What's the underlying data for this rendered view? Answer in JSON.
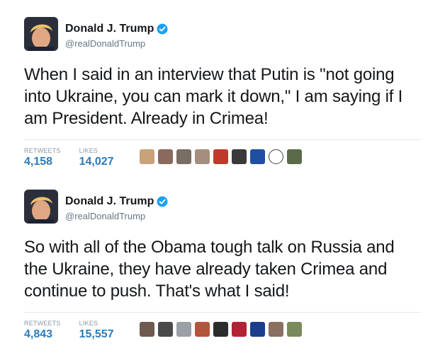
{
  "tweets": [
    {
      "author_name": "Donald J. Trump",
      "handle": "@realDonaldTrump",
      "text": "When I said in an interview that Putin is \"not going into Ukraine, you can mark it down,\" I am saying if I am President. Already in Crimea!",
      "retweets_label": "RETWEETS",
      "retweets": "4,158",
      "likes_label": "LIKES",
      "likes": "14,027",
      "liker_avatars": [
        {
          "icon": "liker-avatar-icon",
          "color": "#c9a27a"
        },
        {
          "icon": "liker-avatar-icon",
          "color": "#8a6a5c"
        },
        {
          "icon": "liker-avatar-icon",
          "color": "#7a6e62"
        },
        {
          "icon": "liker-avatar-icon",
          "color": "#a58f7c"
        },
        {
          "icon": "liker-avatar-icon",
          "color": "#c0392b"
        },
        {
          "icon": "liker-avatar-icon",
          "color": "#3a3a3a"
        },
        {
          "icon": "liker-avatar-icon",
          "color": "#1f4fa0"
        },
        {
          "icon": "liker-avatar-icon",
          "color": "#ffffff"
        },
        {
          "icon": "liker-avatar-icon",
          "color": "#5b6b4a"
        }
      ]
    },
    {
      "author_name": "Donald J. Trump",
      "handle": "@realDonaldTrump",
      "text": "So with all of the Obama tough talk on Russia and the Ukraine, they have already taken Crimea and continue to push. That's what I said!",
      "retweets_label": "RETWEETS",
      "retweets": "4,843",
      "likes_label": "LIKES",
      "likes": "15,557",
      "liker_avatars": [
        {
          "icon": "liker-avatar-icon",
          "color": "#6e5a50"
        },
        {
          "icon": "liker-avatar-icon",
          "color": "#4a4a4a"
        },
        {
          "icon": "liker-avatar-icon",
          "color": "#9aa0a6"
        },
        {
          "icon": "liker-avatar-icon",
          "color": "#b5543c"
        },
        {
          "icon": "liker-avatar-icon",
          "color": "#2c2c2c"
        },
        {
          "icon": "liker-avatar-icon",
          "color": "#b22234"
        },
        {
          "icon": "liker-avatar-icon",
          "color": "#1a3e8c"
        },
        {
          "icon": "liker-avatar-icon",
          "color": "#8a7060"
        },
        {
          "icon": "liker-avatar-icon",
          "color": "#7b8a5a"
        }
      ]
    }
  ],
  "colors": {
    "verified": "#1da1f2",
    "stat_value": "#2b7bb9",
    "handle": "#657786"
  }
}
